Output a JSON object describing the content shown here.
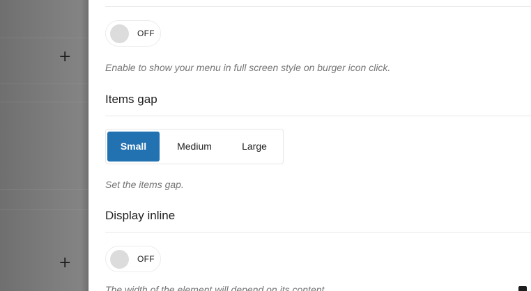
{
  "backdrop": {
    "add_icon_1": "+",
    "add_icon_2": "+"
  },
  "fullscreen": {
    "toggle_state": "OFF",
    "help": "Enable to show your menu in full screen style on burger icon click."
  },
  "items_gap": {
    "title": "Items gap",
    "options": [
      "Small",
      "Medium",
      "Large"
    ],
    "selected": "Small",
    "help": "Set the items gap."
  },
  "display_inline": {
    "title": "Display inline",
    "toggle_state": "OFF",
    "help": "The width of the element will depend on its content."
  },
  "colors": {
    "accent": "#2271b1",
    "help_text": "#757575",
    "text": "#1e1e1e"
  }
}
